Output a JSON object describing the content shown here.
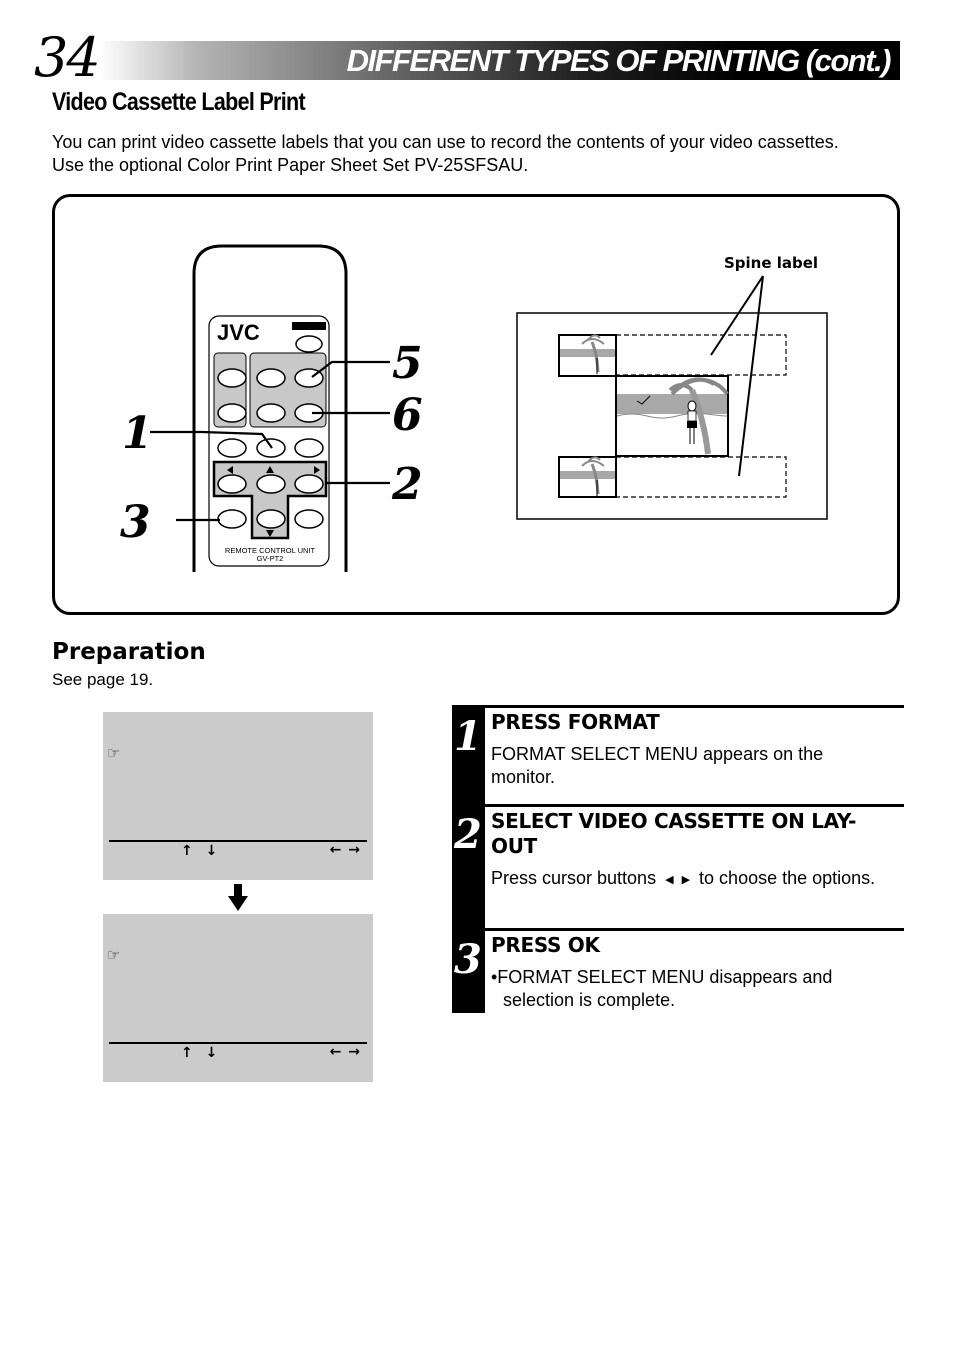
{
  "header": {
    "page_number": "34",
    "title": "DIFFERENT TYPES OF PRINTING (cont.)"
  },
  "section": {
    "title": "Video Cassette Label Print",
    "intro": "You can print video cassette labels that you can use to record the contents of your video cassettes. Use the optional Color Print Paper Sheet Set PV-25SFSAU."
  },
  "illustration": {
    "remote": {
      "brand": "JVC",
      "caption_line1": "REMOTE CONTROL UNIT",
      "caption_line2": "GV-PT2",
      "callouts": [
        "1",
        "2",
        "3",
        "5",
        "6"
      ]
    },
    "layout": {
      "spine_label": "Spine label"
    }
  },
  "preparation": {
    "title": "Preparation",
    "text": "See page 19."
  },
  "screens": [
    {
      "pointer_icon": "☞",
      "updown": "↑ ↓",
      "leftright": "← →"
    },
    {
      "pointer_icon": "☞",
      "updown": "↑ ↓",
      "leftright": "← →"
    }
  ],
  "steps": [
    {
      "number": "1",
      "heading": "PRESS FORMAT",
      "body": "FORMAT SELECT MENU appears on the monitor."
    },
    {
      "number": "2",
      "heading": "SELECT VIDEO CASSETTE ON LAY-OUT",
      "body_before": "Press cursor buttons",
      "left_arrow": "◀",
      "right_arrow": "▶",
      "body_after": "to choose the options."
    },
    {
      "number": "3",
      "heading": "PRESS OK",
      "body": "•FORMAT SELECT MENU disappears and selection is complete."
    }
  ]
}
